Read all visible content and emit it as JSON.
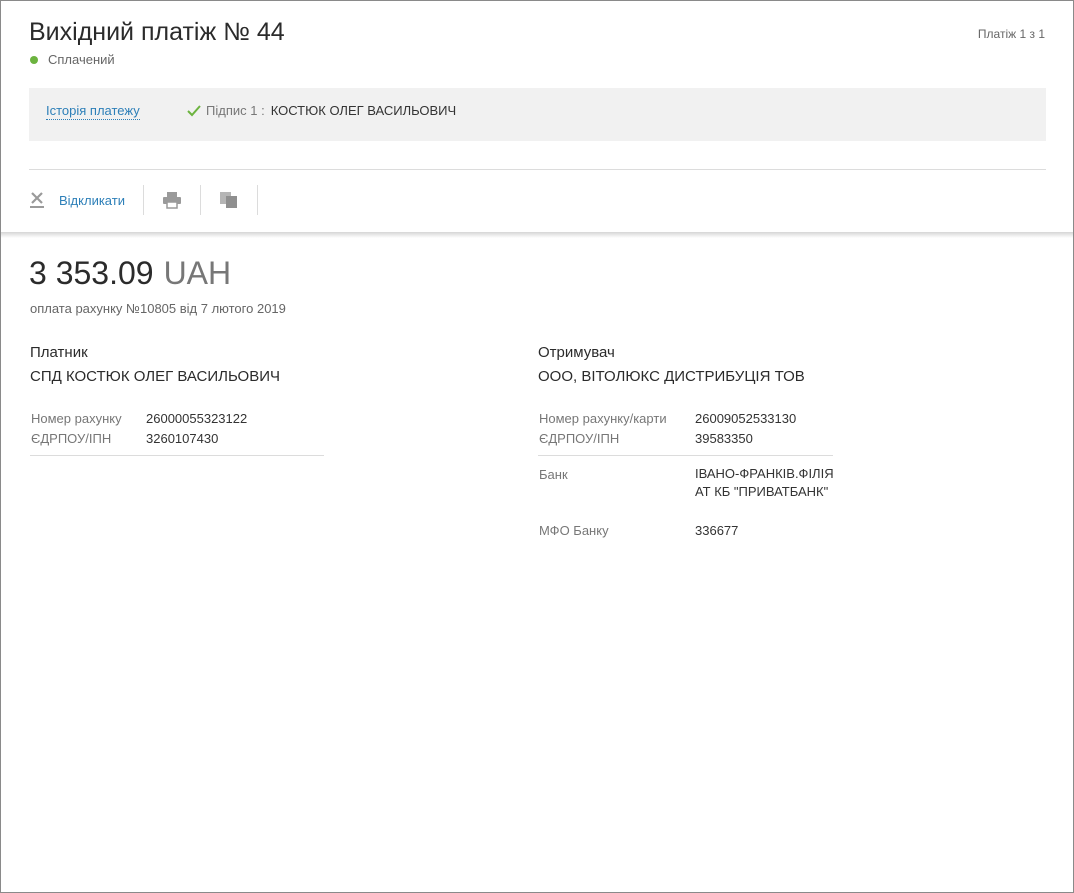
{
  "header": {
    "title": "Вихідний платіж № 44",
    "status": "Сплачений",
    "status_color": "#6cb33f",
    "pager": "Платіж 1 з 1"
  },
  "signatures": {
    "history_link": "Історія платежу",
    "signature_label": "Підпис 1 :",
    "signature_name": "КОСТЮК ОЛЕГ ВАСИЛЬОВИЧ"
  },
  "toolbar": {
    "revoke_label": "Відкликати",
    "icons": [
      "close-icon",
      "print-icon",
      "copy-icon"
    ]
  },
  "payment": {
    "amount": "3 353.09",
    "currency": "UAH",
    "purpose": "оплата рахунку №10805 від 7 лютого 2019"
  },
  "payer": {
    "title": "Платник",
    "name": "СПД КОСТЮК ОЛЕГ ВАСИЛЬОВИЧ",
    "account_label": "Номер рахунку",
    "account": "26000055323122",
    "edrpou_label": "ЄДРПОУ/ІПН",
    "edrpou": "3260107430"
  },
  "recipient": {
    "title": "Отримувач",
    "name": "ООО, ВІТОЛЮКС ДИСТРИБУЦІЯ ТОВ",
    "account_label": "Номер рахунку/карти",
    "account": "26009052533130",
    "edrpou_label": "ЄДРПОУ/ІПН",
    "edrpou": "39583350",
    "bank_label": "Банк",
    "bank": "ІВАНО-ФРАНКІВ.ФІЛІЯ АТ КБ \"ПРИВАТБАНК\"",
    "mfo_label": "МФО Банку",
    "mfo": "336677"
  },
  "colors": {
    "link": "#2d7fb8",
    "panel": "#f1f1f1"
  }
}
